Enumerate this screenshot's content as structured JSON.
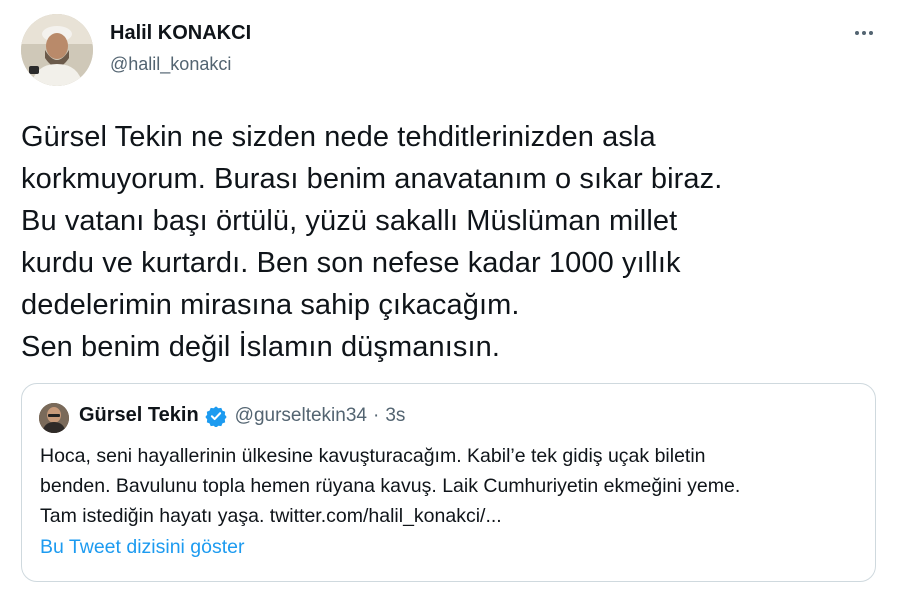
{
  "author": {
    "name": "Halil KONAKCI",
    "handle": "@halil_konakci",
    "avatar_icon": "user-avatar-photo"
  },
  "more_icon": "more-options-icon",
  "tweet": {
    "text": "Gürsel Tekin ne sizden nede tehditlerinizden asla\nkorkmuyorum. Burası benim anavatanım o sıkar biraz.\nBu vatanı başı örtülü, yüzü sakallı Müslüman millet\nkurdu ve kurtardı. Ben son nefese kadar 1000 yıllık\ndedelerimin mirasına sahip çıkacağım.\nSen benim değil İslamın düşmanısın."
  },
  "quoted": {
    "name": "Gürsel Tekin",
    "verified_icon": "verified-badge-icon",
    "handle": "@gurseltekin34",
    "separator": "·",
    "time": "3s",
    "text": "Hoca, seni hayallerinin ülkesine kavuşturacağım. Kabil’e tek gidiş uçak biletin\nbenden. Bavulunu topla hemen rüyana kavuş. Laik Cumhuriyetin ekmeğini yeme.\nTam istediğin hayatı yaşa. twitter.com/halil_konakci/...",
    "thread_link": "Bu Tweet dizisini göster"
  },
  "colors": {
    "text": "#0f1419",
    "secondary": "#536471",
    "link": "#1d9bf0",
    "border": "#cfd9de",
    "verified": "#1d9bf0"
  }
}
